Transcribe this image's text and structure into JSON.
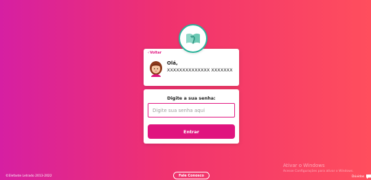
{
  "logo": {
    "icon": "book-logo-icon"
  },
  "user_card": {
    "back_label": "Voltar",
    "greeting": "Olá,",
    "username": "XXXXXXXXXXXXXX XXXXXXX"
  },
  "password_card": {
    "title": "Digite a sua senha:",
    "input_placeholder": "Digite sua senha aqui",
    "input_value": "",
    "submit_label": "Entrar"
  },
  "footer": {
    "copyright": "©Elefante Letrado 2013-2022",
    "contact_label": "Fale Conosco",
    "help_label": "Dúvidas"
  },
  "windows_watermark": {
    "title": "Ativar o Windows",
    "subtitle": "Acesse Configurações para ativar o Windows."
  },
  "colors": {
    "primary": "#e0147f",
    "teal": "#2bb49b",
    "gradient_start": "#d61fa2",
    "gradient_end": "#ff4e5d"
  }
}
